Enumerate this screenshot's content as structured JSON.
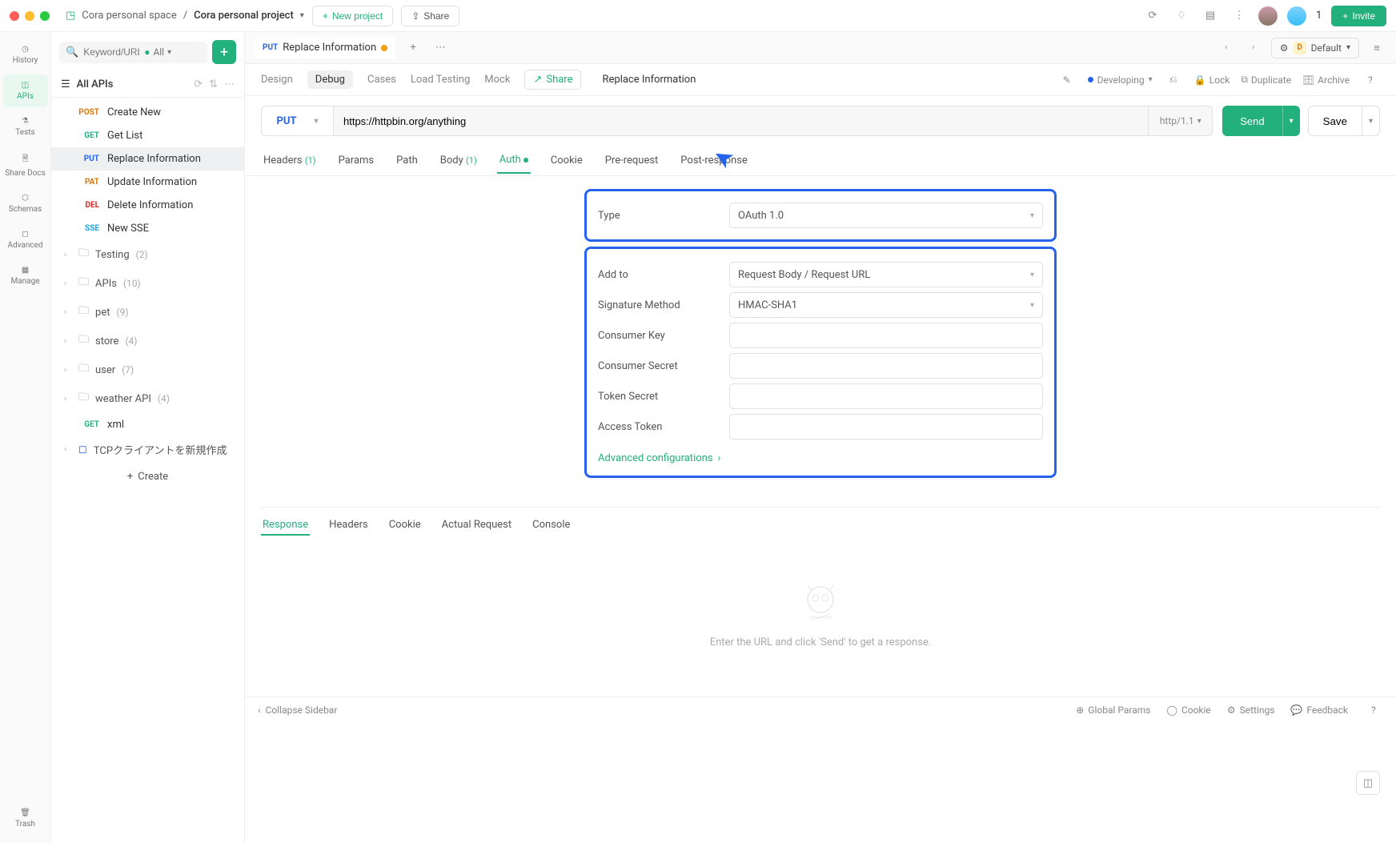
{
  "breadcrumb": {
    "space": "Cora personal space",
    "project": "Cora personal project"
  },
  "topbar": {
    "new_project": "New project",
    "share": "Share",
    "invite": "Invite",
    "count": "1"
  },
  "search": {
    "placeholder": "Keyword/URL",
    "filter": "All"
  },
  "all_apis_label": "All APIs",
  "api_items": [
    {
      "method": "POST",
      "label": "Create New"
    },
    {
      "method": "GET",
      "label": "Get List"
    },
    {
      "method": "PUT",
      "label": "Replace Information",
      "selected": true
    },
    {
      "method": "PAT",
      "label": "Update Information"
    },
    {
      "method": "DEL",
      "label": "Delete Information"
    },
    {
      "method": "SSE",
      "label": "New SSE"
    }
  ],
  "folders": [
    {
      "label": "Testing",
      "count": "(2)"
    },
    {
      "label": "APIs",
      "count": "(10)"
    },
    {
      "label": "pet",
      "count": "(9)"
    },
    {
      "label": "store",
      "count": "(4)"
    },
    {
      "label": "user",
      "count": "(7)"
    },
    {
      "label": "weather API",
      "count": "(4)"
    }
  ],
  "xml_item": {
    "method": "GET",
    "label": "xml"
  },
  "tcp_item": "TCPクライアントを新規作成",
  "create_label": "Create",
  "rail": {
    "history": "History",
    "apis": "APIs",
    "tests": "Tests",
    "share": "Share Docs",
    "schemas": "Schemas",
    "advanced": "Advanced",
    "manage": "Manage",
    "trash": "Trash"
  },
  "tab": {
    "method": "PUT",
    "title": "Replace Information"
  },
  "env": {
    "letter": "D",
    "name": "Default"
  },
  "subnav": {
    "design": "Design",
    "debug": "Debug",
    "cases": "Cases",
    "load": "Load Testing",
    "mock": "Mock",
    "share": "Share",
    "title": "Replace Information",
    "status": "Developing",
    "lock": "Lock",
    "duplicate": "Duplicate",
    "archive": "Archive"
  },
  "request": {
    "method": "PUT",
    "url": "https://httpbin.org/anything",
    "protocol": "http/1.1",
    "send": "Send",
    "save": "Save"
  },
  "req_tabs": {
    "headers": "Headers",
    "headers_badge": "(1)",
    "params": "Params",
    "path": "Path",
    "body": "Body",
    "body_badge": "(1)",
    "auth": "Auth",
    "cookie": "Cookie",
    "pre": "Pre-request",
    "post": "Post-response"
  },
  "auth": {
    "type_label": "Type",
    "type_value": "OAuth 1.0",
    "addto_label": "Add to",
    "addto_value": "Request Body / Request URL",
    "sig_label": "Signature Method",
    "sig_value": "HMAC-SHA1",
    "ck_label": "Consumer Key",
    "cs_label": "Consumer Secret",
    "ts_label": "Token Secret",
    "at_label": "Access Token",
    "adv": "Advanced configurations"
  },
  "resp_tabs": {
    "response": "Response",
    "headers": "Headers",
    "cookie": "Cookie",
    "actual": "Actual Request",
    "console": "Console"
  },
  "resp_empty": "Enter the URL and click 'Send' to get a response.",
  "footer": {
    "collapse": "Collapse Sidebar",
    "global": "Global Params",
    "cookie": "Cookie",
    "settings": "Settings",
    "feedback": "Feedback"
  }
}
